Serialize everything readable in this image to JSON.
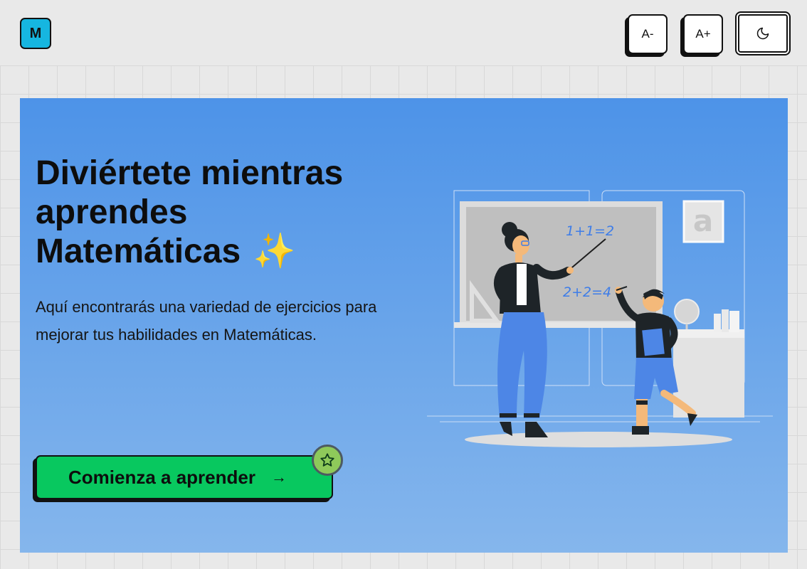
{
  "header": {
    "logo_letter": "M",
    "decrease_font_label": "A-",
    "increase_font_label": "A+",
    "theme_toggle_icon": "moon-icon"
  },
  "hero": {
    "title_line1": "Diviértete mientras",
    "title_line2": "aprendes",
    "title_line3": "Matemáticas",
    "title_emoji": "✨",
    "description": "Aquí encontrarás una variedad de ejercicios para mejorar tus habilidades en Matemáticas.",
    "cta_label": "Comienza a aprender",
    "cta_arrow": "→",
    "badge_icon": "star-icon",
    "illustration": {
      "board_equation_1": "1+1=2",
      "board_equation_2": "2+2=4",
      "frame_letter": "a"
    }
  },
  "colors": {
    "logo_bg": "#16b6e0",
    "hero_gradient_top": "#4d93e8",
    "hero_gradient_bottom": "#85b6ec",
    "cta_bg": "#08c85f",
    "badge_bg": "#8ec95a"
  }
}
